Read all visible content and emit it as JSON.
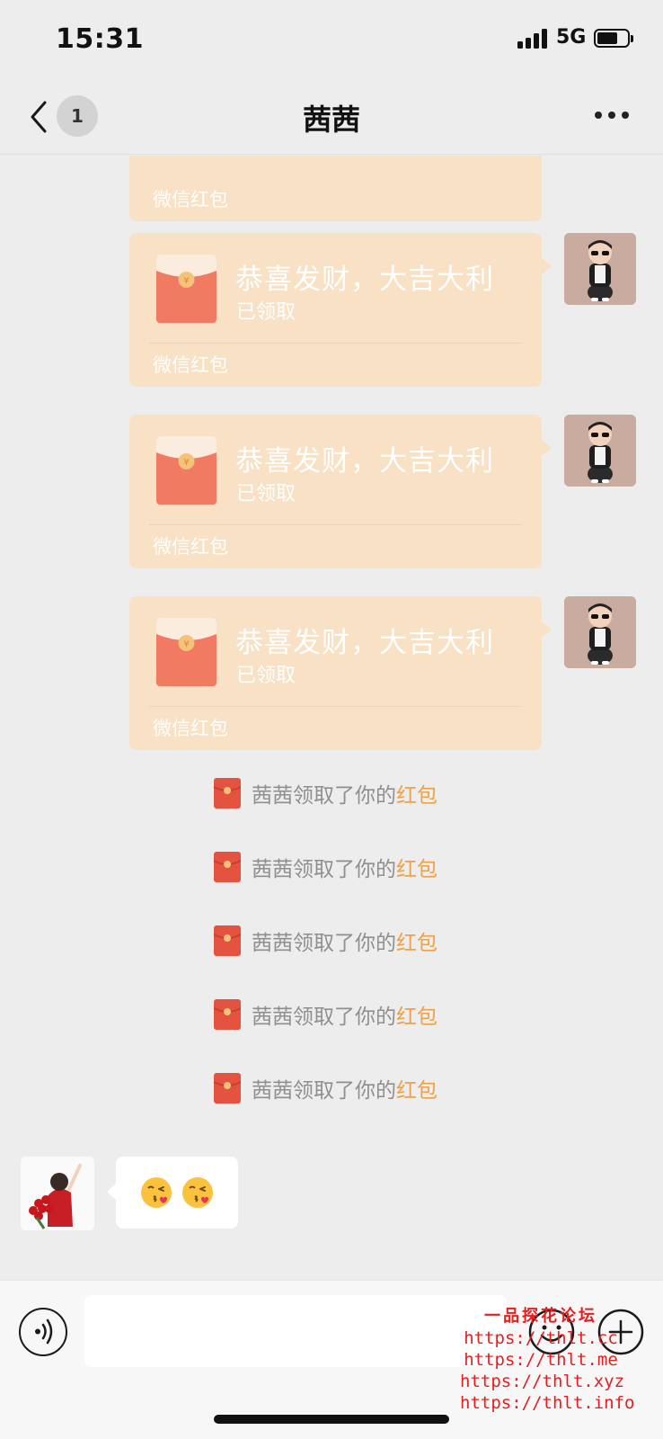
{
  "status_bar": {
    "time": "15:31",
    "network": "5G",
    "icons": [
      "signal-icon",
      "battery-icon"
    ]
  },
  "nav": {
    "back_icon": "chevron-left-icon",
    "unread_count": "1",
    "title": "茜茜",
    "more_icon": "more-dots-icon"
  },
  "messages": {
    "partial_red_packet": {
      "footer": "微信红包"
    },
    "red_packets": [
      {
        "title": "恭喜发财，大吉大利",
        "status": "已领取",
        "footer": "微信红包"
      },
      {
        "title": "恭喜发财，大吉大利",
        "status": "已领取",
        "footer": "微信红包"
      },
      {
        "title": "恭喜发财，大吉大利",
        "status": "已领取",
        "footer": "微信红包"
      }
    ],
    "system_notices": [
      {
        "text": "茜茜领取了你的",
        "link": "红包"
      },
      {
        "text": "茜茜领取了你的",
        "link": "红包"
      },
      {
        "text": "茜茜领取了你的",
        "link": "红包"
      },
      {
        "text": "茜茜领取了你的",
        "link": "红包"
      },
      {
        "text": "茜茜领取了你的",
        "link": "红包"
      }
    ],
    "incoming_emoji": {
      "emojis": [
        "kissing-heart-emoji",
        "kissing-heart-emoji"
      ]
    }
  },
  "input_bar": {
    "voice_icon": "voice-icon",
    "input_value": "",
    "emoji_icon": "emoji-face-icon",
    "plus_icon": "plus-circle-icon"
  },
  "watermark": {
    "title": "一品探花论坛",
    "lines": [
      "https://thlt.cc",
      "https://thlt.me",
      "https://thlt.xyz",
      "https://thlt.info"
    ]
  },
  "colors": {
    "background": "#ededed",
    "red_packet_card": "#f8e1c5",
    "envelope": "#f07a62",
    "link": "#f0a046",
    "watermark": "#e51f1f"
  }
}
